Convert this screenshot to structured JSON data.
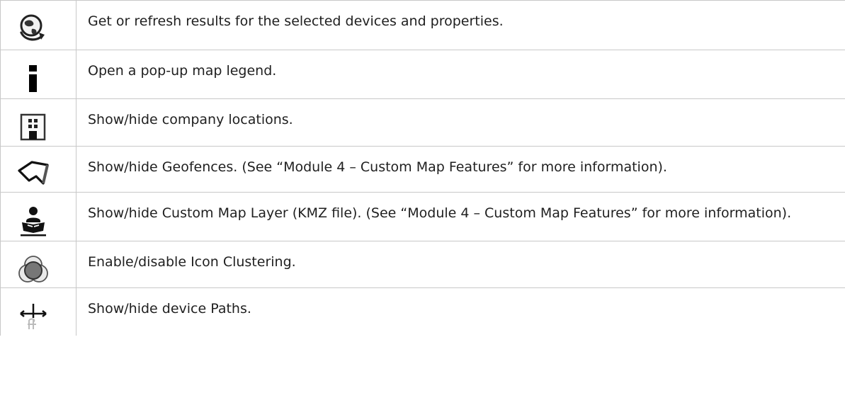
{
  "rows": [
    {
      "icon": "globe-refresh-icon",
      "text": "Get or refresh results for the selected devices and properties."
    },
    {
      "icon": "info-icon",
      "text": "Open a pop-up map legend."
    },
    {
      "icon": "building-icon",
      "text": "Show/hide company locations."
    },
    {
      "icon": "geofence-icon",
      "text": "Show/hide Geofences. (See “Module 4 – Custom Map Features” for more information)."
    },
    {
      "icon": "map-layer-reader-icon",
      "text": "Show/hide Custom Map Layer (KMZ file). (See “Module 4 – Custom Map Features” for more information)."
    },
    {
      "icon": "cluster-icon",
      "text": "Enable/disable Icon Clustering."
    },
    {
      "icon": "paths-icon",
      "text": "Show/hide device Paths."
    }
  ]
}
